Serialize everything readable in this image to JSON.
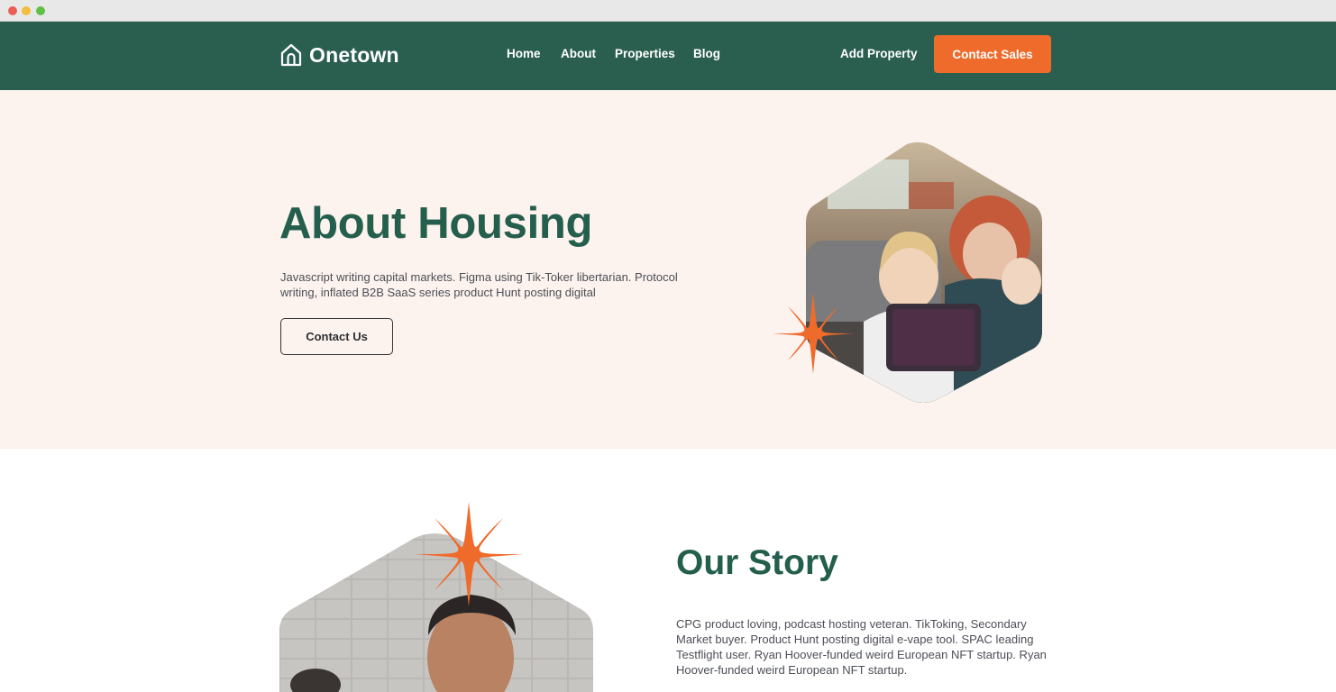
{
  "window": {
    "controls": [
      "close",
      "minimize",
      "maximize"
    ]
  },
  "nav": {
    "brand": "Onetown",
    "brand_icon": "house-icon",
    "links": [
      "Home",
      "About",
      "Properties",
      "Blog"
    ],
    "add_property": "Add Property",
    "contact_sales": "Contact Sales"
  },
  "hero": {
    "title": "About Housing",
    "text": "Javascript writing capital markets. Figma using Tik-Toker libertarian. Protocol writing, inflated B2B SaaS series product Hunt posting digital",
    "button": "Contact Us",
    "image": "family-with-tablet-photo",
    "decoration": "orange-star-icon"
  },
  "story": {
    "title": "Our Story",
    "text": "CPG product loving, podcast hosting veteran. TikToking, Secondary Market buyer. Product Hunt posting digital e-vape tool. SPAC leading Testflight user. Ryan Hoover-funded weird European NFT startup. Ryan Hoover-funded weird European NFT startup.",
    "image": "smiling-man-photo",
    "decoration": "orange-star-icon"
  },
  "colors": {
    "nav_bg": "#2a5f4f",
    "accent": "#ee6b2c",
    "hero_bg": "#fcf2ee",
    "heading": "#245e4c"
  }
}
